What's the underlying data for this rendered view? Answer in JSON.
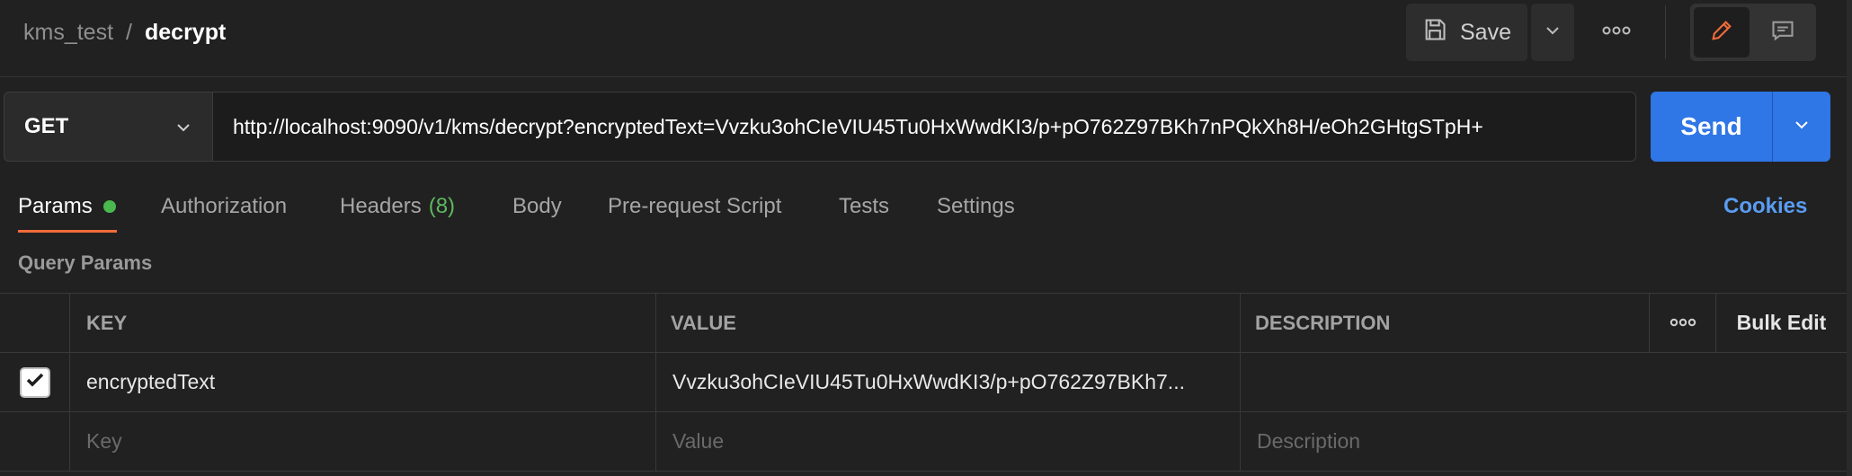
{
  "breadcrumb": {
    "parent": "kms_test",
    "separator": "/",
    "current": "decrypt"
  },
  "toolbar": {
    "save_label": "Save",
    "save_icon": "floppy-disk-icon",
    "save_dropdown_icon": "chevron-down-icon",
    "more_icon": "more-horizontal-icon",
    "edit_icon": "pencil-icon",
    "comments_icon": "comment-icon"
  },
  "request": {
    "method": "GET",
    "url": "http://localhost:9090/v1/kms/decrypt?encryptedText=Vvzku3ohCIeVIU45Tu0HxWwdKI3/p+pO762Z97BKh7nPQkXh8H/eOh2GHtgSTpH+",
    "send_label": "Send"
  },
  "tabs": [
    {
      "label": "Params",
      "active": true,
      "has_dot": true
    },
    {
      "label": "Authorization"
    },
    {
      "label": "Headers",
      "count": "(8)"
    },
    {
      "label": "Body"
    },
    {
      "label": "Pre-request Script"
    },
    {
      "label": "Tests"
    },
    {
      "label": "Settings"
    }
  ],
  "cookies_label": "Cookies",
  "query_params": {
    "title": "Query Params",
    "columns": {
      "key": "KEY",
      "value": "VALUE",
      "description": "DESCRIPTION",
      "bulk_edit": "Bulk Edit"
    },
    "rows": [
      {
        "checked": true,
        "key": "encryptedText",
        "value": "Vvzku3ohCIeVIU45Tu0HxWwdKI3/p+pO762Z97BKh7...",
        "description": ""
      }
    ],
    "placeholders": {
      "key": "Key",
      "value": "Value",
      "description": "Description"
    }
  },
  "colors": {
    "accent_send": "#2f76e6",
    "active_tab_underline": "#f26b3a",
    "params_dot": "#49b84f",
    "cookies_link": "#5a9cf2",
    "edit_icon": "#f26b3a"
  }
}
